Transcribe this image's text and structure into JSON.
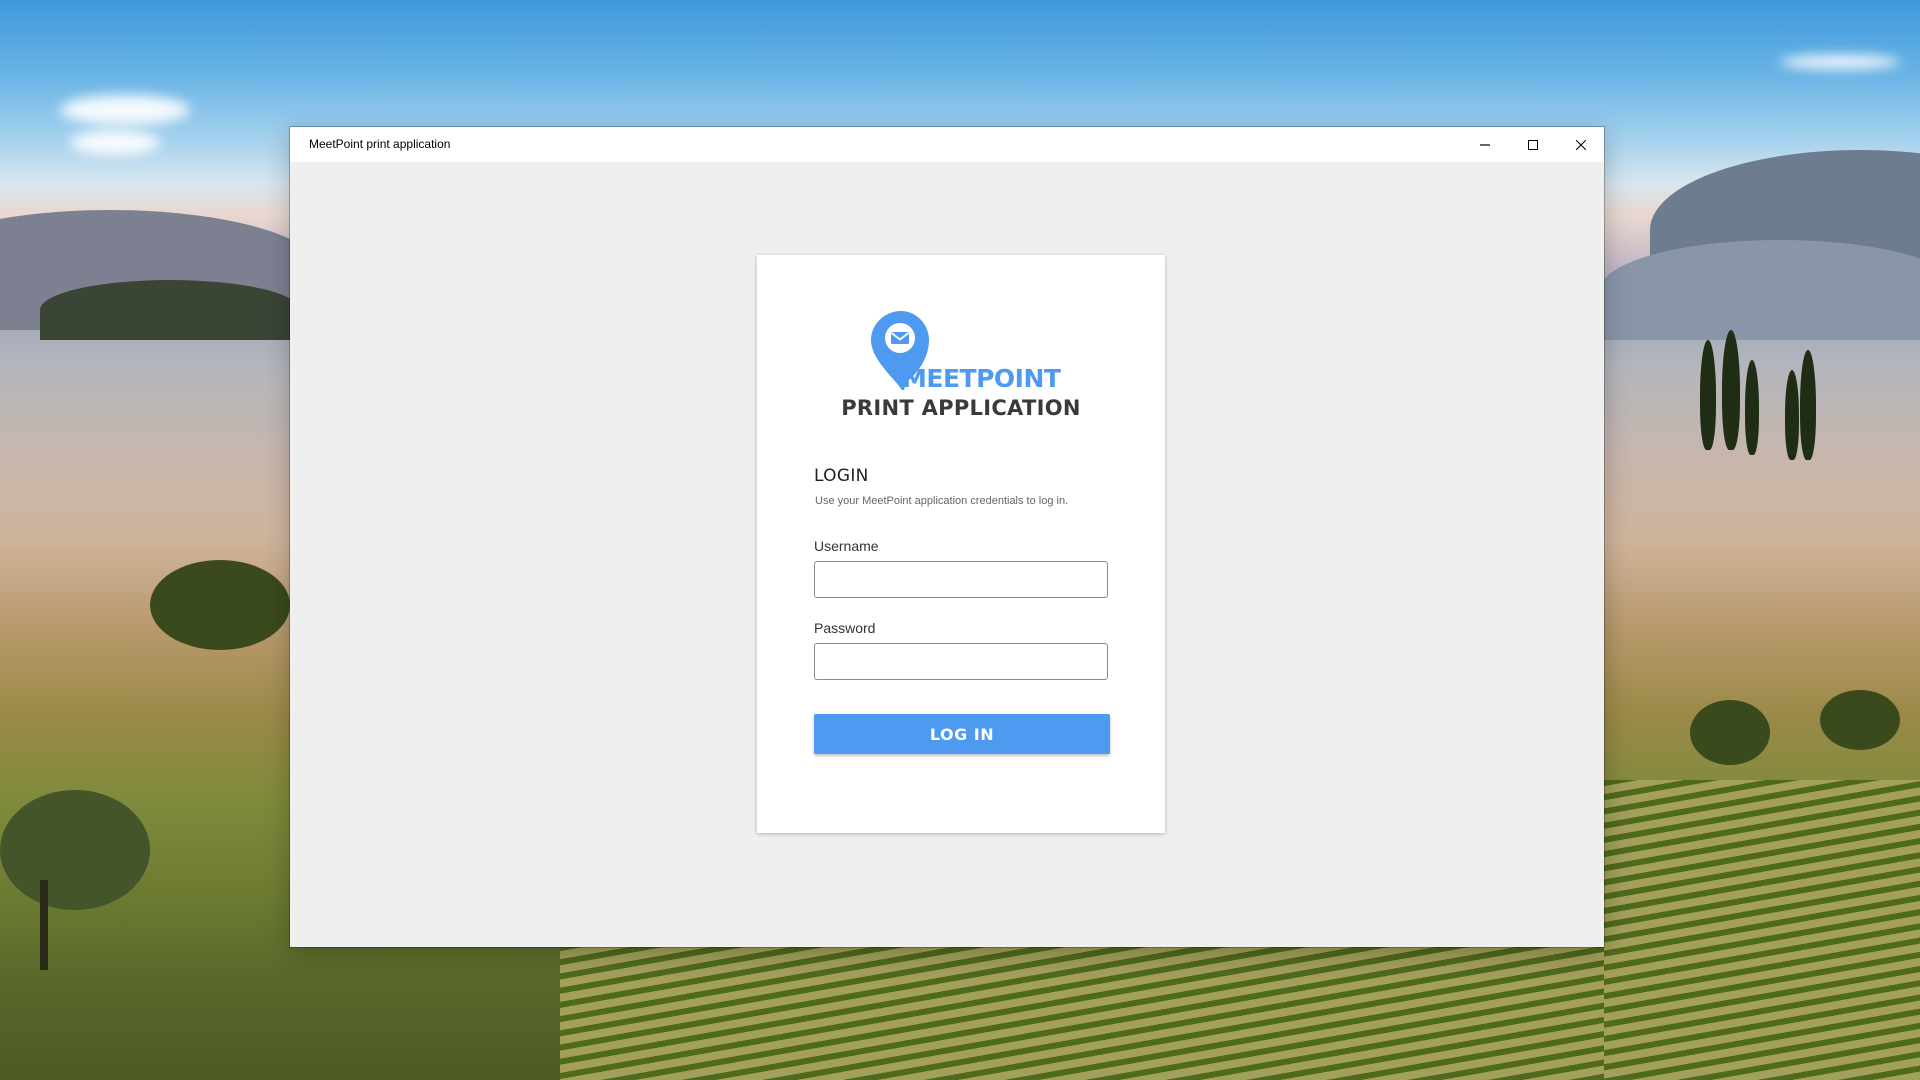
{
  "window": {
    "title": "MeetPoint print application",
    "controls": [
      "minimize-icon",
      "maximize-icon",
      "close-icon"
    ]
  },
  "brand": {
    "name": "MEETPOINT",
    "subtitle": "PRINT APPLICATION",
    "logo_icon": "map-pin-envelope-icon",
    "accent_color": "#4d9af0"
  },
  "login": {
    "heading": "LOGIN",
    "description": "Use your MeetPoint application credentials to log in.",
    "username_label": "Username",
    "username_value": "",
    "password_label": "Password",
    "password_value": "",
    "submit_label": "LOG IN"
  }
}
